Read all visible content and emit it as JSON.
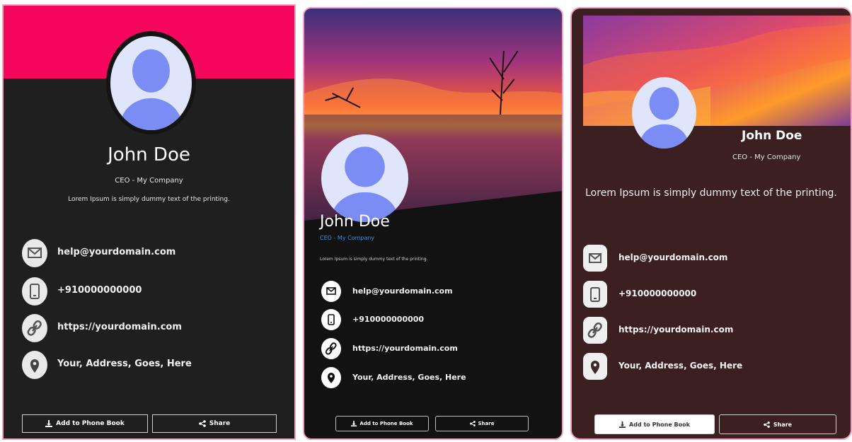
{
  "cards": [
    {
      "name": "John Doe",
      "role": "CEO - My Company",
      "description": "Lorem Ipsum is simply dummy text of the printing.",
      "contacts": [
        {
          "icon": "envelope-icon",
          "value": "help@yourdomain.com"
        },
        {
          "icon": "phone-icon",
          "value": "+910000000000"
        },
        {
          "icon": "link-icon",
          "value": "https://yourdomain.com"
        },
        {
          "icon": "location-pin-icon",
          "value": "Your, Address, Goes, Here"
        }
      ],
      "buttons": {
        "add": "Add to Phone Book",
        "share": "Share"
      },
      "colors": {
        "band": "#f5075d",
        "background": "#1f1f1f"
      }
    },
    {
      "name": "John Doe",
      "role": "CEO - My Company",
      "description": "Lorem Ipsum is simply dummy text of the printing.",
      "contacts": [
        {
          "icon": "envelope-icon",
          "value": "help@yourdomain.com"
        },
        {
          "icon": "phone-icon",
          "value": "+910000000000"
        },
        {
          "icon": "link-icon",
          "value": "https://yourdomain.com"
        },
        {
          "icon": "location-pin-icon",
          "value": "Your, Address, Goes, Here"
        }
      ],
      "buttons": {
        "add": "Add to Phone Book",
        "share": "Share"
      },
      "colors": {
        "accent": "#3b8fe0",
        "background": "#121212"
      }
    },
    {
      "name": "John Doe",
      "role": "CEO - My Company",
      "description": "Lorem Ipsum is simply dummy text of the printing.",
      "contacts": [
        {
          "icon": "envelope-icon",
          "value": "help@yourdomain.com"
        },
        {
          "icon": "phone-icon",
          "value": "+910000000000"
        },
        {
          "icon": "link-icon",
          "value": "https://yourdomain.com"
        },
        {
          "icon": "location-pin-icon",
          "value": "Your, Address, Goes, Here"
        }
      ],
      "buttons": {
        "add": "Add to Phone Book",
        "share": "Share"
      },
      "colors": {
        "background": "#3b1f21"
      }
    }
  ]
}
